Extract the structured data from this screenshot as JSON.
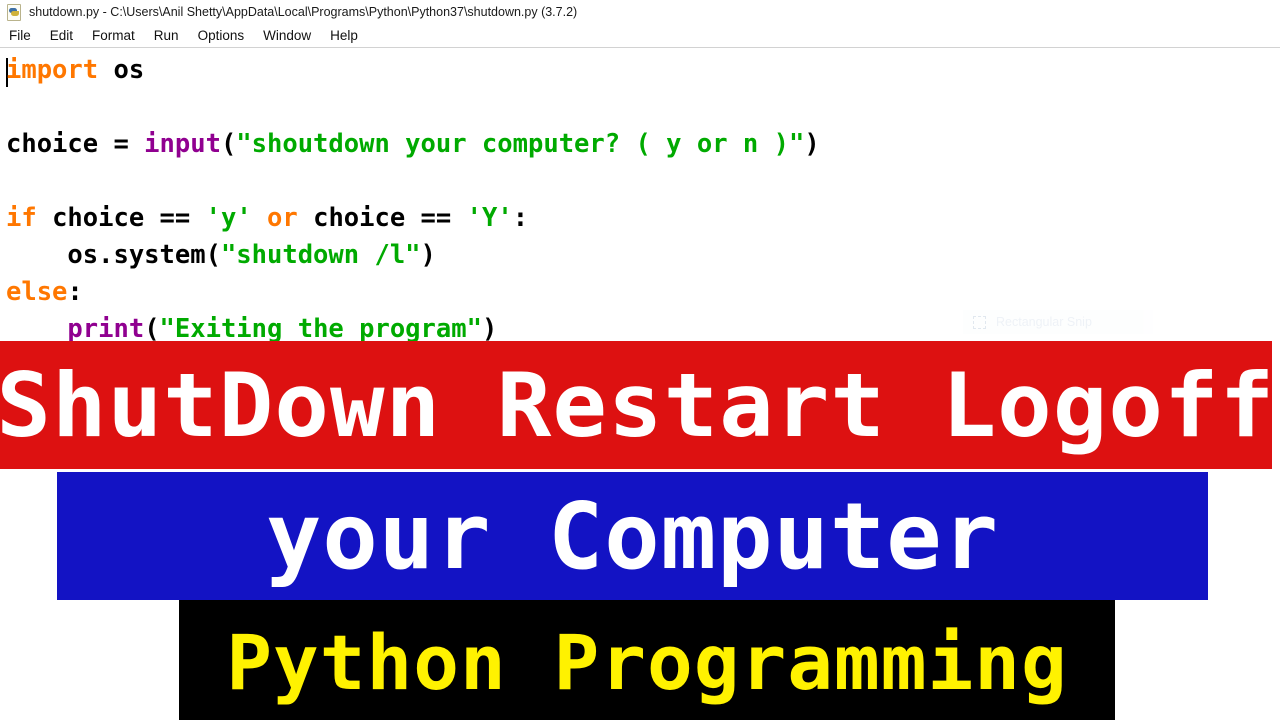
{
  "window": {
    "icon": "python-idle-file-icon",
    "title": "shutdown.py - C:\\Users\\Anil Shetty\\AppData\\Local\\Programs\\Python\\Python37\\shutdown.py (3.7.2)"
  },
  "menu": {
    "items": [
      {
        "label": "File"
      },
      {
        "label": "Edit"
      },
      {
        "label": "Format"
      },
      {
        "label": "Run"
      },
      {
        "label": "Options"
      },
      {
        "label": "Window"
      },
      {
        "label": "Help"
      }
    ]
  },
  "editor": {
    "language": "python",
    "caret_visible": true,
    "syntax_colors": {
      "keyword": "#ff7700",
      "builtin": "#900090",
      "string": "#00aa00",
      "default": "#000000"
    },
    "code": "import os\n\nchoice = input(\"shoutdown your computer? ( y or n )\")\n\nif choice == 'y' or choice == 'Y':\n    os.system(\"shutdown /l\")\nelse:\n    print(\"Exiting the program\")",
    "lines": [
      {
        "tokens": [
          {
            "t": "import",
            "k": "kw"
          },
          {
            "t": " os",
            "k": "def"
          }
        ]
      },
      {
        "tokens": []
      },
      {
        "tokens": [
          {
            "t": "choice = ",
            "k": "def"
          },
          {
            "t": "input",
            "k": "bi"
          },
          {
            "t": "(",
            "k": "def"
          },
          {
            "t": "\"shoutdown your computer? ( y or n )\"",
            "k": "str"
          },
          {
            "t": ")",
            "k": "def"
          }
        ]
      },
      {
        "tokens": []
      },
      {
        "tokens": [
          {
            "t": "if",
            "k": "kw"
          },
          {
            "t": " choice == ",
            "k": "def"
          },
          {
            "t": "'y'",
            "k": "str"
          },
          {
            "t": " or ",
            "k": "kw"
          },
          {
            "t": "choice == ",
            "k": "def"
          },
          {
            "t": "'Y'",
            "k": "str"
          },
          {
            "t": ":",
            "k": "def"
          }
        ]
      },
      {
        "tokens": [
          {
            "t": "    os.system(",
            "k": "def"
          },
          {
            "t": "\"shutdown /l\"",
            "k": "str"
          },
          {
            "t": ")",
            "k": "def"
          }
        ]
      },
      {
        "tokens": [
          {
            "t": "else",
            "k": "kw"
          },
          {
            "t": ":",
            "k": "def"
          }
        ]
      },
      {
        "tokens": [
          {
            "t": "    ",
            "k": "def"
          },
          {
            "t": "print",
            "k": "bi"
          },
          {
            "t": "(",
            "k": "def"
          },
          {
            "t": "\"Exiting the program\"",
            "k": "str"
          },
          {
            "t": ")",
            "k": "def"
          }
        ]
      }
    ]
  },
  "snip_tooltip": {
    "label": "Rectangular Snip",
    "icon": "rectangular-snip-icon"
  },
  "overlay_banners": [
    {
      "text": "ShutDown Restart Logoff",
      "background": "#dd1111",
      "color": "#ffffff"
    },
    {
      "text": "your Computer",
      "background": "#1313c4",
      "color": "#ffffff"
    },
    {
      "text": "Python Programming",
      "background": "#000000",
      "color": "#fff200"
    }
  ]
}
